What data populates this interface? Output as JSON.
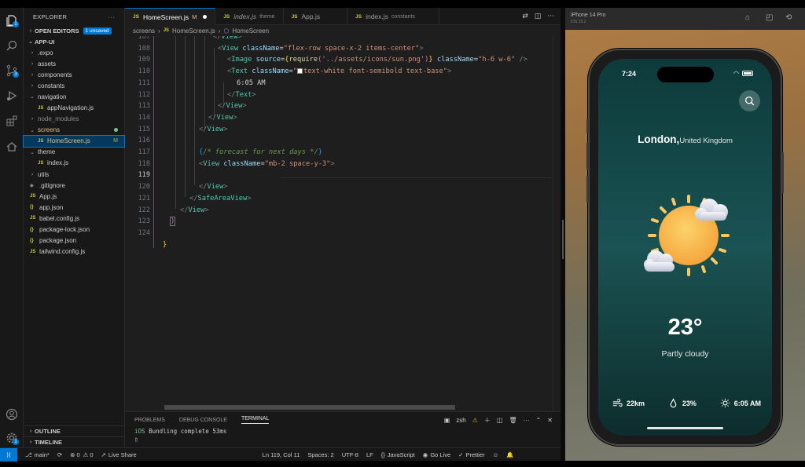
{
  "explorer": {
    "title": "EXPLORER",
    "more": "···",
    "open_editors": "OPEN EDITORS",
    "unsaved_badge": "1 unsaved",
    "project": "APP-UI",
    "items": [
      {
        "depth": 1,
        "kind": "folder",
        "open": false,
        "name": ".expo",
        "dim": false
      },
      {
        "depth": 1,
        "kind": "folder",
        "open": false,
        "name": "assets"
      },
      {
        "depth": 1,
        "kind": "folder",
        "open": false,
        "name": "components"
      },
      {
        "depth": 1,
        "kind": "folder",
        "open": false,
        "name": "constants"
      },
      {
        "depth": 1,
        "kind": "folder",
        "open": true,
        "name": "navigation"
      },
      {
        "depth": 2,
        "kind": "js",
        "name": "appNavigation.js"
      },
      {
        "depth": 1,
        "kind": "folder",
        "open": false,
        "name": "node_modules",
        "dim": true
      },
      {
        "depth": 1,
        "kind": "folder",
        "open": true,
        "name": "screens",
        "modified": true
      },
      {
        "depth": 2,
        "kind": "js",
        "name": "HomeScreen.js",
        "status": "M",
        "selected": true
      },
      {
        "depth": 1,
        "kind": "folder",
        "open": true,
        "name": "theme"
      },
      {
        "depth": 2,
        "kind": "js",
        "name": "index.js"
      },
      {
        "depth": 1,
        "kind": "folder",
        "open": false,
        "name": "utils"
      },
      {
        "depth": 1,
        "kind": "git",
        "name": ".gitignore"
      },
      {
        "depth": 1,
        "kind": "js",
        "name": "App.js"
      },
      {
        "depth": 1,
        "kind": "json",
        "name": "app.json"
      },
      {
        "depth": 1,
        "kind": "js",
        "name": "babel.config.js"
      },
      {
        "depth": 1,
        "kind": "json",
        "name": "package-lock.json"
      },
      {
        "depth": 1,
        "kind": "json",
        "name": "package.json"
      },
      {
        "depth": 1,
        "kind": "js",
        "name": "tailwind.config.js"
      }
    ],
    "outline": "OUTLINE",
    "timeline": "TIMELINE"
  },
  "activity": {
    "explorer_badge": "1",
    "scm_badge": "3",
    "settings_badge": "1"
  },
  "tabs": [
    {
      "name": "HomeScreen.js",
      "flag": "M",
      "active": true,
      "dirty": true
    },
    {
      "name": "index.js",
      "sub": "theme",
      "italic": true
    },
    {
      "name": "App.js"
    },
    {
      "name": "index.js",
      "sub": "constants"
    }
  ],
  "breadcrumb": [
    "screens",
    "HomeScreen.js",
    "HomeScreen"
  ],
  "code": {
    "line_numbers": [
      "107",
      "108",
      "109",
      "110",
      "111",
      "112",
      "113",
      "114",
      "115",
      "116",
      "117",
      "118",
      "119",
      "120",
      "121",
      "122",
      "123",
      "124"
    ],
    "current_line": "119"
  },
  "panel": {
    "tabs": [
      "PROBLEMS",
      "DEBUG CONSOLE",
      "TERMINAL"
    ],
    "shell": "zsh",
    "output_platform": "iOS",
    "output_text": "Bundling complete 53ms",
    "prompt": "▯"
  },
  "status": {
    "branch": "main*",
    "errors": "0",
    "warnings": "0",
    "live_share": "Live Share",
    "position": "Ln 119, Col 11",
    "spaces": "Spaces: 2",
    "encoding": "UTF-8",
    "eol": "LF",
    "language": "JavaScript",
    "go_live": "Go Live",
    "prettier": "Prettier"
  },
  "simulator": {
    "device": "iPhone 14 Pro",
    "os": "iOS 16.2",
    "time": "7:24",
    "city": "London,",
    "country": "United Kingdom",
    "temperature": "23°",
    "condition": "Partly cloudy",
    "wind": "22km",
    "humidity": "23%",
    "sunrise": "6:05 AM",
    "colors": {
      "sun": "#f7b84b",
      "bg_top": "#0e3a3a",
      "bg_bottom": "#0d2d2d"
    }
  }
}
